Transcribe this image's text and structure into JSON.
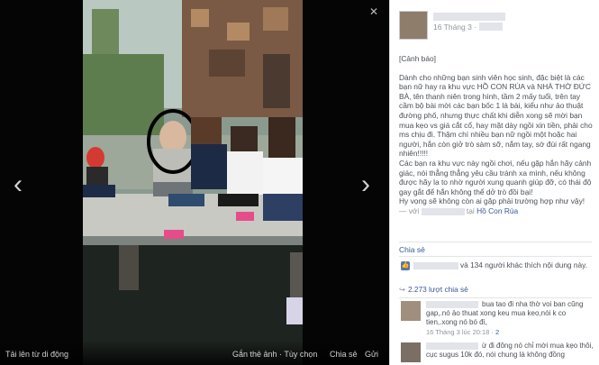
{
  "viewer": {
    "prev_arrow": "‹",
    "next_arrow": "›",
    "close_glyph": "✕",
    "upload_label": "Tải lên từ di động",
    "tag_label": "Gắn thẻ ảnh · Tùy chọn",
    "share_label": "Chia sẻ",
    "send_label": "Gửi"
  },
  "post": {
    "date": "16 Tháng 3 ·",
    "warning_title": "[Cảnh báo]",
    "body_1": "Dành cho những bạn sinh viên học sinh, đặc biệt là các bạn nữ hay ra khu vực HỒ CON RÙA và NHÀ THỜ ĐỨC BÀ, tên thanh niên trong hình, tầm 2 mấy tuổi, trên tay cầm bộ bài mời các bạn bốc 1 lá bài, kiểu như ảo thuật đường phố, nhưng thực chất khi diễn xong sẽ mời bạn mua kẹo vs giá cắt cổ, hay mặt dày ngồi xin tiền, phải cho ms chịu đi. Thậm chí nhiều bạn nữ ngồi một hoặc hai người, hắn còn giở trò sàm sỡ, nắm tay, sờ đùi rất ngang nhiên!!!!!",
    "body_2": "Các bạn ra khu vực này ngồi chơi, nếu gặp hắn hãy cảnh giác, nói thẳng thẳng yêu cầu tránh xa mình, nếu không được hãy la to nhờ người xung quanh giúp đỡ, có thái độ gay gắt để hắn không thể dở trò đồi bại!",
    "body_3": "Hy vọng sẽ không còn ai gặp phải trường hợp như vậy!",
    "with_prefix": "— với",
    "at_text": "tại",
    "location": "Hồ Con Rùa"
  },
  "actions": {
    "share": "Chia sẻ"
  },
  "stats": {
    "like_glyph": "👍",
    "likes_text": "và 134 người khác thích nội dung này.",
    "shares_text": "2.273 lượt chia sẻ"
  },
  "comments": [
    {
      "text": "bua tao đi nha thờ voi ban cũng gap,.nó ảo thuat xong keu mua keo,nói k co tien,.xong nó bó đi,",
      "meta": "16 Tháng 3 lúc 20:18 ·",
      "like": "2"
    },
    {
      "text": "ừ đi đông nó chỉ mời mua kẹo thôi, cục sugus 10k đó, nói chung là không đồng",
      "meta": "",
      "like": ""
    }
  ]
}
